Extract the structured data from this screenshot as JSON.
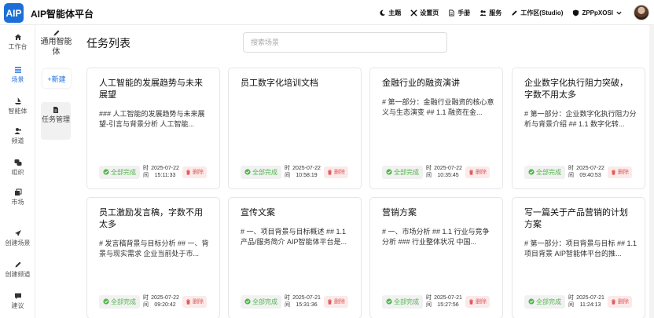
{
  "header": {
    "logo": "AIP",
    "title": "AIP智能体平台",
    "nav": [
      {
        "icon": "moon-icon",
        "label": "主题"
      },
      {
        "icon": "tools-icon",
        "label": "设置页"
      },
      {
        "icon": "file-icon",
        "label": "手册"
      },
      {
        "icon": "users-icon",
        "label": "服务"
      },
      {
        "icon": "pen-icon",
        "label": "工作区(Studio)"
      },
      {
        "icon": "shield-icon",
        "label": "ZPPpXOSI"
      }
    ]
  },
  "sidebar": {
    "items": [
      {
        "icon": "home-icon",
        "label": "工作台"
      },
      {
        "icon": "grid-icon",
        "label": "场景"
      },
      {
        "icon": "ship-icon",
        "label": "智能体"
      },
      {
        "icon": "user-icon",
        "label": "频道"
      },
      {
        "icon": "group-icon",
        "label": "组织"
      },
      {
        "icon": "store-icon",
        "label": "市场"
      },
      {
        "icon": "send-icon",
        "label": "创建场景"
      },
      {
        "icon": "pen-icon",
        "label": "创建频道"
      },
      {
        "icon": "comment-icon",
        "label": "建议"
      }
    ]
  },
  "col2": {
    "agent_label": "通用智能体",
    "new_label": "+新建",
    "task_mgmt_label": "任务管理"
  },
  "main": {
    "title": "任务列表",
    "search_placeholder": "搜索场景",
    "time_label": "时间",
    "status_label": "全部完成",
    "delete_label": "删除",
    "cards": [
      {
        "title": "人工智能的发展趋势与未来展望",
        "desc": "### 人工智能的发展趋势与未来展望-引言与背景分析 人工智能...",
        "time": "2025-07-22 15:11:33"
      },
      {
        "title": "员工数字化培训文档",
        "desc": "",
        "time": "2025-07-22 10:58:19"
      },
      {
        "title": "金融行业的融资演讲",
        "desc": "# 第一部分：金融行业融资的核心意义与生态演变 ## 1.1 融资在金...",
        "time": "2025-07-22 10:35:45"
      },
      {
        "title": "企业数字化执行阻力突破，字数不用太多",
        "desc": "# 第一部分：企业数字化执行阻力分析与背景介绍 ## 1.1 数字化转...",
        "time": "2025-07-22 09:40:53"
      },
      {
        "title": "员工激励发言稿，字数不用太多",
        "desc": "# 发言稿背景与目标分析 ## 一、背景与现实需求 企业当前处于市...",
        "time": "2025-07-22 09:20:42"
      },
      {
        "title": "宣传文案",
        "desc": "# 一、项目背景与目标概述 ## 1.1 产品/服务简介 AIP智能体平台是...",
        "time": "2025-07-21 15:31:36"
      },
      {
        "title": "营销方案",
        "desc": "# 一、市场分析 ## 1.1 行业与竞争分析 ### 行业整体状况 中国...",
        "time": "2025-07-21 15:27:56"
      },
      {
        "title": "写一篇关于产品营销的计划方案",
        "desc": "# 第一部分：项目背景与目标 ## 1.1 项目背景 AIP智能体平台的推...",
        "time": "2025-07-21 11:24:13"
      }
    ]
  },
  "colors": {
    "brand": "#1d6fd8",
    "success": "#52b64a",
    "danger": "#e05a5a"
  }
}
